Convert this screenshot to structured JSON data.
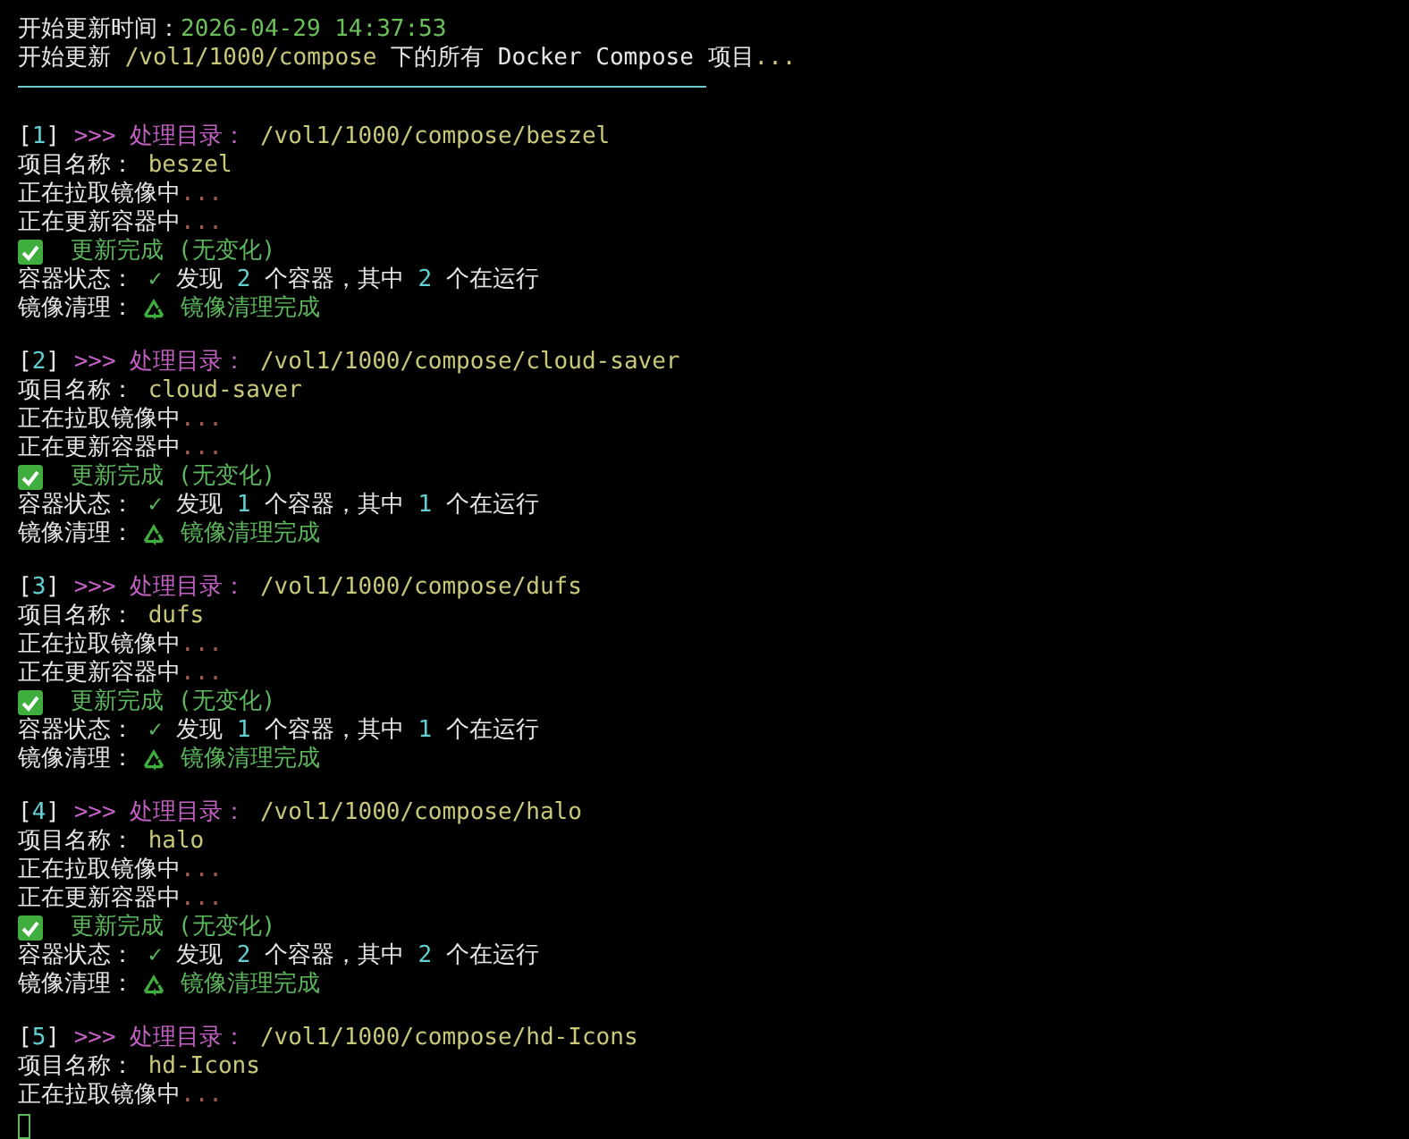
{
  "terminal": {
    "lines": [
      {
        "kind": "text",
        "segments": [
          {
            "kind": "plain",
            "text": "开始更新时间："
          },
          {
            "kind": "time",
            "text": "2026-04-29 14:37:53"
          }
        ]
      },
      {
        "kind": "text",
        "segments": [
          {
            "kind": "plain",
            "text": "开始更新 "
          },
          {
            "kind": "path",
            "text": "/vol1/1000/compose"
          },
          {
            "kind": "plain",
            "text": " 下的所有 Docker Compose 项目"
          },
          {
            "kind": "path",
            "text": "..."
          }
        ]
      },
      {
        "kind": "rule"
      },
      {
        "kind": "blank"
      },
      {
        "kind": "text",
        "segments": [
          {
            "kind": "plain",
            "text": "["
          },
          {
            "kind": "number",
            "text": "1"
          },
          {
            "kind": "plain",
            "text": "] "
          },
          {
            "kind": "prompt",
            "text": ">>> 处理目录："
          },
          {
            "kind": "path",
            "text": " /vol1/1000/compose/beszel"
          }
        ]
      },
      {
        "kind": "text",
        "segments": [
          {
            "kind": "plain",
            "text": "项目名称："
          },
          {
            "kind": "path",
            "text": " beszel"
          }
        ]
      },
      {
        "kind": "text",
        "segments": [
          {
            "kind": "plain",
            "text": "正在拉取镜像中"
          },
          {
            "kind": "dots",
            "text": "..."
          }
        ]
      },
      {
        "kind": "text",
        "segments": [
          {
            "kind": "plain",
            "text": "正在更新容器中"
          },
          {
            "kind": "dots",
            "text": "..."
          }
        ]
      },
      {
        "kind": "text",
        "segments": [
          {
            "kind": "check-icon"
          },
          {
            "kind": "success",
            "text": "  更新完成 (无变化)"
          }
        ]
      },
      {
        "kind": "text",
        "segments": [
          {
            "kind": "plain",
            "text": "容器状态："
          },
          {
            "kind": "success",
            "text": " ✓"
          },
          {
            "kind": "plain",
            "text": " 发现 "
          },
          {
            "kind": "number",
            "text": "2"
          },
          {
            "kind": "plain",
            "text": " 个容器，其中 "
          },
          {
            "kind": "number",
            "text": "2"
          },
          {
            "kind": "plain",
            "text": " 个在运行"
          }
        ]
      },
      {
        "kind": "text",
        "segments": [
          {
            "kind": "plain",
            "text": "镜像清理："
          },
          {
            "kind": "recycle-icon"
          },
          {
            "kind": "success",
            "text": " 镜像清理完成"
          }
        ]
      },
      {
        "kind": "blank"
      },
      {
        "kind": "text",
        "segments": [
          {
            "kind": "plain",
            "text": "["
          },
          {
            "kind": "number",
            "text": "2"
          },
          {
            "kind": "plain",
            "text": "] "
          },
          {
            "kind": "prompt",
            "text": ">>> 处理目录："
          },
          {
            "kind": "path",
            "text": " /vol1/1000/compose/cloud-saver"
          }
        ]
      },
      {
        "kind": "text",
        "segments": [
          {
            "kind": "plain",
            "text": "项目名称："
          },
          {
            "kind": "path",
            "text": " cloud-saver"
          }
        ]
      },
      {
        "kind": "text",
        "segments": [
          {
            "kind": "plain",
            "text": "正在拉取镜像中"
          },
          {
            "kind": "dots",
            "text": "..."
          }
        ]
      },
      {
        "kind": "text",
        "segments": [
          {
            "kind": "plain",
            "text": "正在更新容器中"
          },
          {
            "kind": "dots",
            "text": "..."
          }
        ]
      },
      {
        "kind": "text",
        "segments": [
          {
            "kind": "check-icon"
          },
          {
            "kind": "success",
            "text": "  更新完成 (无变化)"
          }
        ]
      },
      {
        "kind": "text",
        "segments": [
          {
            "kind": "plain",
            "text": "容器状态："
          },
          {
            "kind": "success",
            "text": " ✓"
          },
          {
            "kind": "plain",
            "text": " 发现 "
          },
          {
            "kind": "number",
            "text": "1"
          },
          {
            "kind": "plain",
            "text": " 个容器，其中 "
          },
          {
            "kind": "number",
            "text": "1"
          },
          {
            "kind": "plain",
            "text": " 个在运行"
          }
        ]
      },
      {
        "kind": "text",
        "segments": [
          {
            "kind": "plain",
            "text": "镜像清理："
          },
          {
            "kind": "recycle-icon"
          },
          {
            "kind": "success",
            "text": " 镜像清理完成"
          }
        ]
      },
      {
        "kind": "blank"
      },
      {
        "kind": "text",
        "segments": [
          {
            "kind": "plain",
            "text": "["
          },
          {
            "kind": "number",
            "text": "3"
          },
          {
            "kind": "plain",
            "text": "] "
          },
          {
            "kind": "prompt",
            "text": ">>> 处理目录："
          },
          {
            "kind": "path",
            "text": " /vol1/1000/compose/dufs"
          }
        ]
      },
      {
        "kind": "text",
        "segments": [
          {
            "kind": "plain",
            "text": "项目名称："
          },
          {
            "kind": "path",
            "text": " dufs"
          }
        ]
      },
      {
        "kind": "text",
        "segments": [
          {
            "kind": "plain",
            "text": "正在拉取镜像中"
          },
          {
            "kind": "dots",
            "text": "..."
          }
        ]
      },
      {
        "kind": "text",
        "segments": [
          {
            "kind": "plain",
            "text": "正在更新容器中"
          },
          {
            "kind": "dots",
            "text": "..."
          }
        ]
      },
      {
        "kind": "text",
        "segments": [
          {
            "kind": "check-icon"
          },
          {
            "kind": "success",
            "text": "  更新完成 (无变化)"
          }
        ]
      },
      {
        "kind": "text",
        "segments": [
          {
            "kind": "plain",
            "text": "容器状态："
          },
          {
            "kind": "success",
            "text": " ✓"
          },
          {
            "kind": "plain",
            "text": " 发现 "
          },
          {
            "kind": "number",
            "text": "1"
          },
          {
            "kind": "plain",
            "text": " 个容器，其中 "
          },
          {
            "kind": "number",
            "text": "1"
          },
          {
            "kind": "plain",
            "text": " 个在运行"
          }
        ]
      },
      {
        "kind": "text",
        "segments": [
          {
            "kind": "plain",
            "text": "镜像清理："
          },
          {
            "kind": "recycle-icon"
          },
          {
            "kind": "success",
            "text": " 镜像清理完成"
          }
        ]
      },
      {
        "kind": "blank"
      },
      {
        "kind": "text",
        "segments": [
          {
            "kind": "plain",
            "text": "["
          },
          {
            "kind": "number",
            "text": "4"
          },
          {
            "kind": "plain",
            "text": "] "
          },
          {
            "kind": "prompt",
            "text": ">>> 处理目录："
          },
          {
            "kind": "path",
            "text": " /vol1/1000/compose/halo"
          }
        ]
      },
      {
        "kind": "text",
        "segments": [
          {
            "kind": "plain",
            "text": "项目名称："
          },
          {
            "kind": "path",
            "text": " halo"
          }
        ]
      },
      {
        "kind": "text",
        "segments": [
          {
            "kind": "plain",
            "text": "正在拉取镜像中"
          },
          {
            "kind": "dots",
            "text": "..."
          }
        ]
      },
      {
        "kind": "text",
        "segments": [
          {
            "kind": "plain",
            "text": "正在更新容器中"
          },
          {
            "kind": "dots",
            "text": "..."
          }
        ]
      },
      {
        "kind": "text",
        "segments": [
          {
            "kind": "check-icon"
          },
          {
            "kind": "success",
            "text": "  更新完成 (无变化)"
          }
        ]
      },
      {
        "kind": "text",
        "segments": [
          {
            "kind": "plain",
            "text": "容器状态："
          },
          {
            "kind": "success",
            "text": " ✓"
          },
          {
            "kind": "plain",
            "text": " 发现 "
          },
          {
            "kind": "number",
            "text": "2"
          },
          {
            "kind": "plain",
            "text": " 个容器，其中 "
          },
          {
            "kind": "number",
            "text": "2"
          },
          {
            "kind": "plain",
            "text": " 个在运行"
          }
        ]
      },
      {
        "kind": "text",
        "segments": [
          {
            "kind": "plain",
            "text": "镜像清理："
          },
          {
            "kind": "recycle-icon"
          },
          {
            "kind": "success",
            "text": " 镜像清理完成"
          }
        ]
      },
      {
        "kind": "blank"
      },
      {
        "kind": "text",
        "segments": [
          {
            "kind": "plain",
            "text": "["
          },
          {
            "kind": "number",
            "text": "5"
          },
          {
            "kind": "plain",
            "text": "] "
          },
          {
            "kind": "prompt",
            "text": ">>> 处理目录："
          },
          {
            "kind": "path",
            "text": " /vol1/1000/compose/hd-Icons"
          }
        ]
      },
      {
        "kind": "text",
        "segments": [
          {
            "kind": "plain",
            "text": "项目名称："
          },
          {
            "kind": "path",
            "text": " hd-Icons"
          }
        ]
      },
      {
        "kind": "text",
        "segments": [
          {
            "kind": "plain",
            "text": "正在拉取镜像中"
          },
          {
            "kind": "dots",
            "text": "..."
          }
        ]
      },
      {
        "kind": "cursor"
      }
    ]
  }
}
